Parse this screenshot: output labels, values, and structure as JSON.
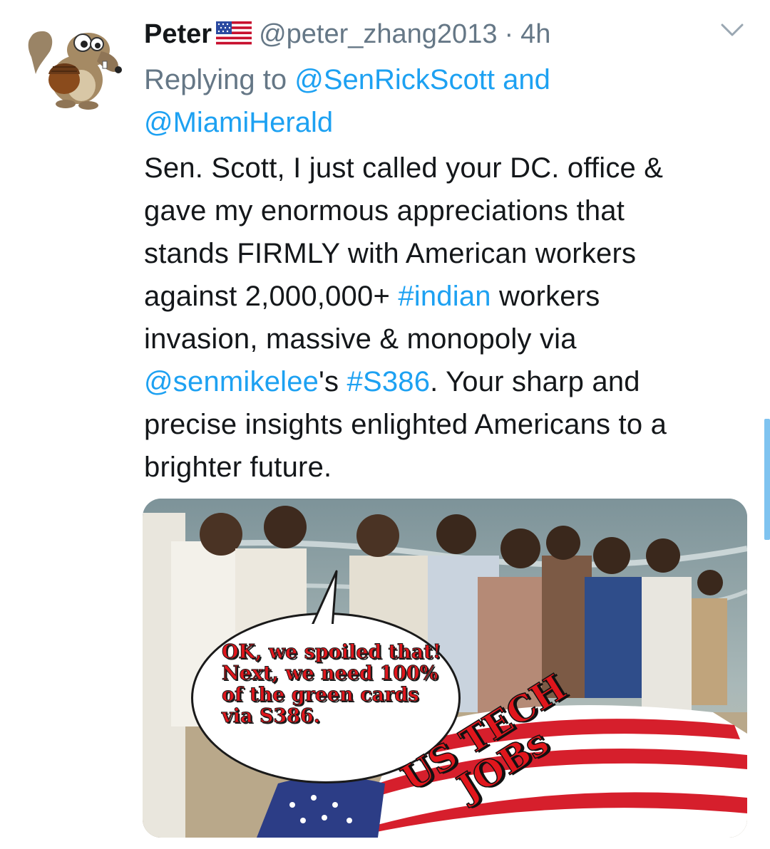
{
  "tweet": {
    "author_name": "Peter",
    "author_flag": "us-flag-icon",
    "handle": "@peter_zhang2013",
    "separator": "·",
    "time": "4h",
    "replying_prefix": "Replying to",
    "reply_mention_1": "@SenRickScott",
    "reply_and": "and",
    "reply_mention_2": "@MiamiHerald",
    "body": {
      "line1": "Sen. Scott, I just called your DC. office &",
      "line2": "gave my enormous appreciations that",
      "line3": "stands FIRMLY with American workers",
      "line4_a": "against 2,000,000+ ",
      "line4_hashtag": "#indian",
      "line4_b": " workers",
      "line5": "invasion, massive & monopoly via",
      "line6_mention": "@senmikelee",
      "line6_a": "'s ",
      "line6_hashtag": "#S386",
      "line6_b": ". Your sharp and",
      "line7": "precise insights enlighted Americans to a",
      "line8": "brighter future."
    }
  },
  "media": {
    "bubble_lines": [
      "OK, we spoiled that!",
      "Next, we need 100%",
      "of the green cards",
      "via S386."
    ],
    "stamp_lines": [
      "US TECH",
      "JOBs"
    ]
  },
  "colors": {
    "link": "#1da1f2",
    "secondary": "#657786",
    "primary_text": "#14171a",
    "meme_red": "#e0161c"
  },
  "icons": {
    "avatar": "squirrel-avatar",
    "menu": "chevron-down-icon"
  }
}
